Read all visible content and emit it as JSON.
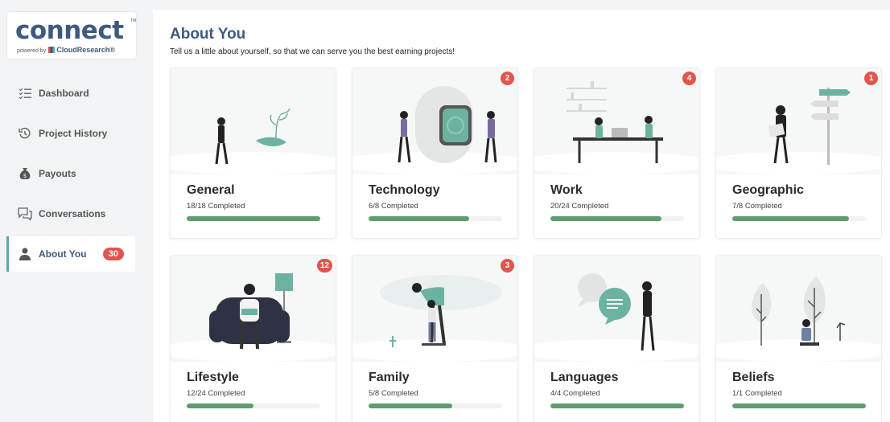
{
  "brand": {
    "logo_text": "connect",
    "tm": "TM",
    "powered_by": "powered by",
    "company": "CloudResearch",
    "registered": "®"
  },
  "sidebar": {
    "items": [
      {
        "label": "Dashboard",
        "icon": "checklist-icon"
      },
      {
        "label": "Project History",
        "icon": "history-icon"
      },
      {
        "label": "Payouts",
        "icon": "money-bag-icon"
      },
      {
        "label": "Conversations",
        "icon": "chat-bubbles-icon"
      },
      {
        "label": "About You",
        "icon": "person-icon",
        "badge": "30",
        "active": true
      }
    ]
  },
  "main": {
    "title": "About You",
    "subtitle": "Tell us a little about yourself, so that we can serve you the best earning projects!"
  },
  "categories": [
    {
      "title": "General",
      "progress_text": "18/18 Completed",
      "progress": 1.0,
      "badge": ""
    },
    {
      "title": "Technology",
      "progress_text": "6/8 Completed",
      "progress": 0.75,
      "badge": "2"
    },
    {
      "title": "Work",
      "progress_text": "20/24 Completed",
      "progress": 0.8333,
      "badge": "4"
    },
    {
      "title": "Geographic",
      "progress_text": "7/8 Completed",
      "progress": 0.875,
      "badge": "1"
    },
    {
      "title": "Lifestyle",
      "progress_text": "12/24 Completed",
      "progress": 0.5,
      "badge": "12"
    },
    {
      "title": "Family",
      "progress_text": "5/8 Completed",
      "progress": 0.625,
      "badge": "3"
    },
    {
      "title": "Languages",
      "progress_text": "4/4 Completed",
      "progress": 1.0,
      "badge": ""
    },
    {
      "title": "Beliefs",
      "progress_text": "1/1 Completed",
      "progress": 1.0,
      "badge": ""
    }
  ],
  "colors": {
    "accent": "#3d5a80",
    "teal": "#5fa8a0",
    "progress": "#5e9e6e",
    "badge": "#e0554d",
    "sidebar_bg": "#f1f3f4"
  }
}
